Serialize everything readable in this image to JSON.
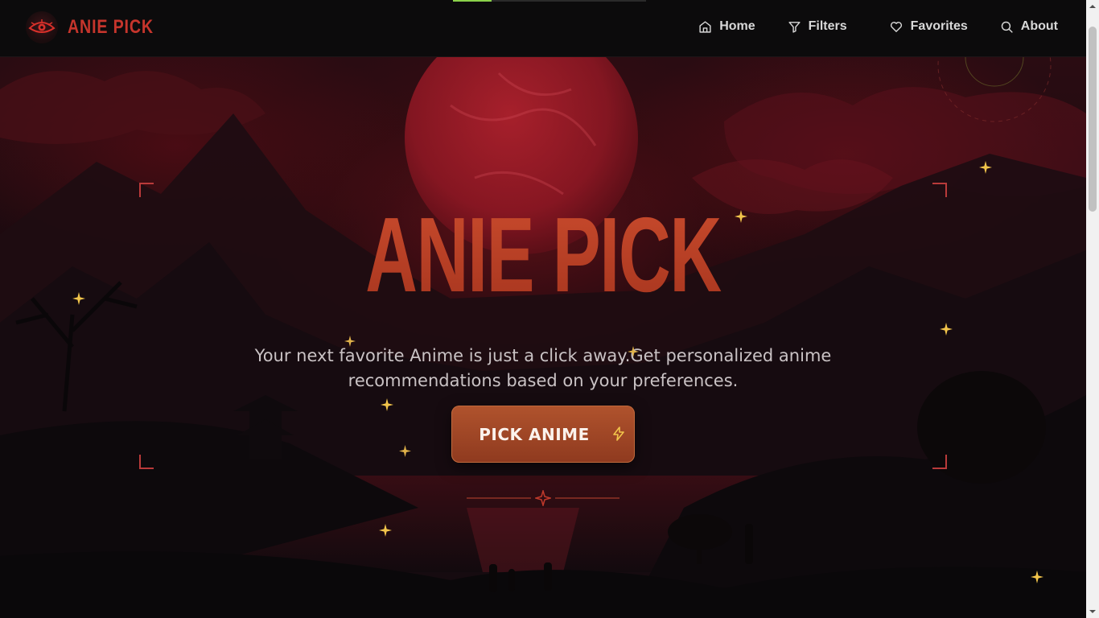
{
  "progress": {
    "fraction": 0.2
  },
  "brand": {
    "name": "ANIE PICK",
    "logo_icon": "eye-icon"
  },
  "nav": {
    "items": [
      {
        "label": "Home",
        "icon": "home-icon"
      },
      {
        "label": "Filters",
        "icon": "filter-icon"
      },
      {
        "label": "Favorites",
        "icon": "heart-icon"
      },
      {
        "label": "About",
        "icon": "search-icon"
      }
    ]
  },
  "hero": {
    "title": "ANIE PICK",
    "subtitle_line1": "Your next favorite Anime is just a click away.Get personalized anime",
    "subtitle_line2": "recommendations based on your preferences.",
    "cta_label": "PICK ANIME",
    "cta_icon": "lightning-icon"
  },
  "colors": {
    "accent": "#c6352c",
    "cta": "#a4492a",
    "sparkle": "#f2c54b"
  }
}
